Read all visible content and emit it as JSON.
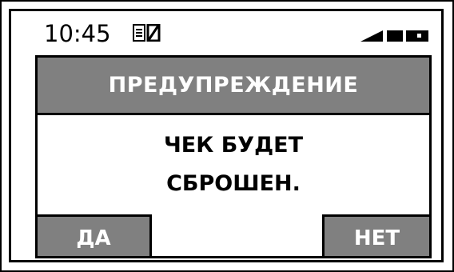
{
  "status_bar": {
    "time": "10:45",
    "icons": [
      "document-icon",
      "zero-icon",
      "signal-icon",
      "battery-icon"
    ]
  },
  "dialog": {
    "title": "ПРЕДУПРЕЖДЕНИЕ",
    "message_lines": [
      "ЧЕК БУДЕТ",
      "СБРОШЕН."
    ]
  },
  "softkeys": {
    "left_label": "ДА",
    "right_label": "НЕТ"
  },
  "colors": {
    "header_bg": "#808080",
    "softkey_bg": "#808080",
    "text_on_gray": "#ffffff",
    "border": "#000000"
  }
}
